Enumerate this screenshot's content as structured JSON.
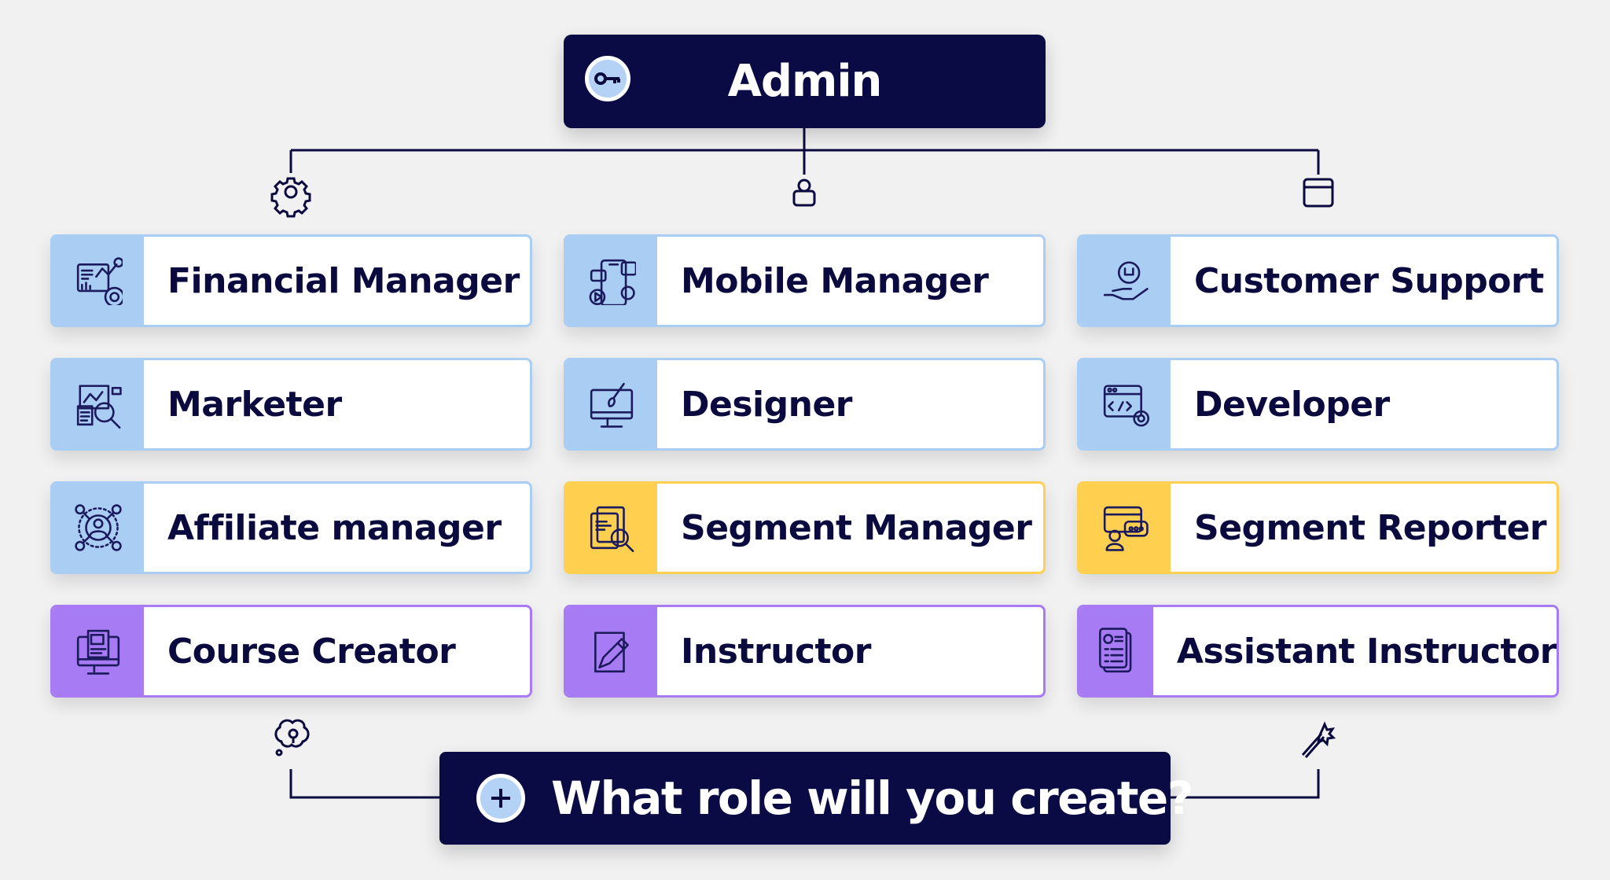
{
  "header": {
    "title": "Admin",
    "icon": "key-icon"
  },
  "colors": {
    "navy": "#0a0a44",
    "blue": "#a9cdf3",
    "yellow": "#ffd04f",
    "purple": "#a77bf3",
    "line": "#0a0a3f"
  },
  "branch_icons": [
    "gear-icon",
    "user-lock-icon",
    "browser-window-icon"
  ],
  "roles": [
    {
      "label": "Financial Manager",
      "icon": "financial-chart-icon",
      "color": "blue"
    },
    {
      "label": "Mobile Manager",
      "icon": "mobile-app-icon",
      "color": "blue"
    },
    {
      "label": "Customer Support",
      "icon": "support-hand-gear-icon",
      "color": "blue"
    },
    {
      "label": "Marketer",
      "icon": "marketing-analysis-icon",
      "color": "blue"
    },
    {
      "label": "Designer",
      "icon": "monitor-brush-icon",
      "color": "blue"
    },
    {
      "label": "Developer",
      "icon": "code-window-gear-icon",
      "color": "blue"
    },
    {
      "label": "Affiliate manager",
      "icon": "affiliate-network-icon",
      "color": "blue"
    },
    {
      "label": "Segment Manager",
      "icon": "document-search-icon",
      "color": "yellow"
    },
    {
      "label": "Segment Reporter",
      "icon": "reporter-chat-icon",
      "color": "yellow"
    },
    {
      "label": "Course Creator",
      "icon": "monitor-document-icon",
      "color": "purple"
    },
    {
      "label": "Instructor",
      "icon": "pencil-paper-icon",
      "color": "purple"
    },
    {
      "label": "Assistant Instructor",
      "icon": "checklist-document-icon",
      "color": "purple"
    }
  ],
  "footer": {
    "title": "What role will you create?",
    "icon": "plus-icon",
    "left_icon": "idea-bulb-icon",
    "right_icon": "magic-wand-icon"
  }
}
